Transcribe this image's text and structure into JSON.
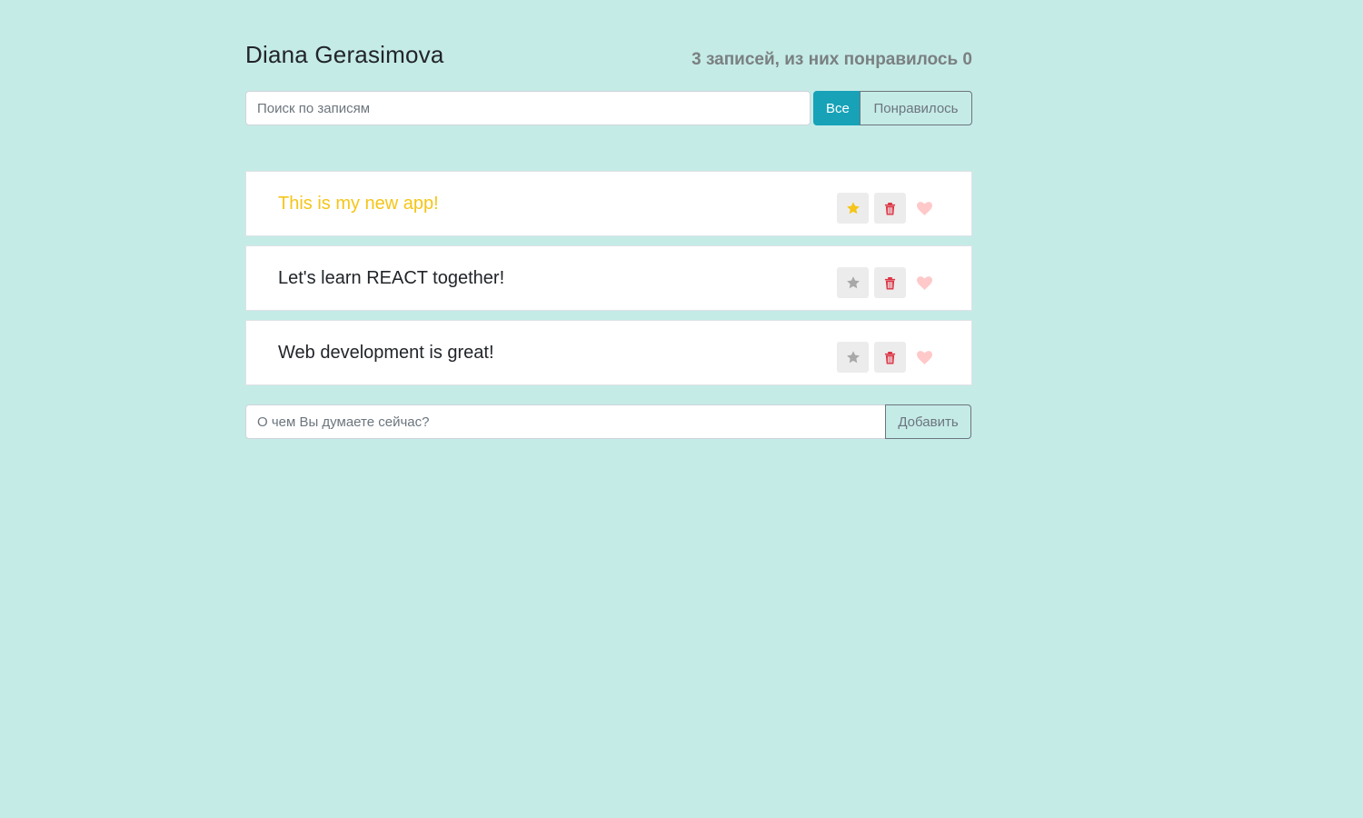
{
  "header": {
    "title": "Diana Gerasimova",
    "summary": "3 записей, из них понравилось 0"
  },
  "search": {
    "placeholder": "Поиск по записям",
    "value": ""
  },
  "filters": {
    "all_label": "Все",
    "liked_label": "Понравилось",
    "active": "all"
  },
  "posts": [
    {
      "label": "This is my new app!",
      "important": true,
      "liked": false
    },
    {
      "label": "Let's learn REACT together!",
      "important": false,
      "liked": false
    },
    {
      "label": "Web development is great!",
      "important": false,
      "liked": false
    }
  ],
  "add_form": {
    "placeholder": "О чем Вы думаете сейчас?",
    "button_label": "Добавить"
  },
  "colors": {
    "background": "#c5ebe7",
    "accent": "#17a2b8",
    "important": "#f5c518",
    "delete": "#dc3545",
    "heart": "#ffc9c9",
    "star_inactive": "#a8a8a8"
  },
  "icons": {
    "star": "star-icon",
    "trash": "trash-icon",
    "heart": "heart-icon"
  }
}
